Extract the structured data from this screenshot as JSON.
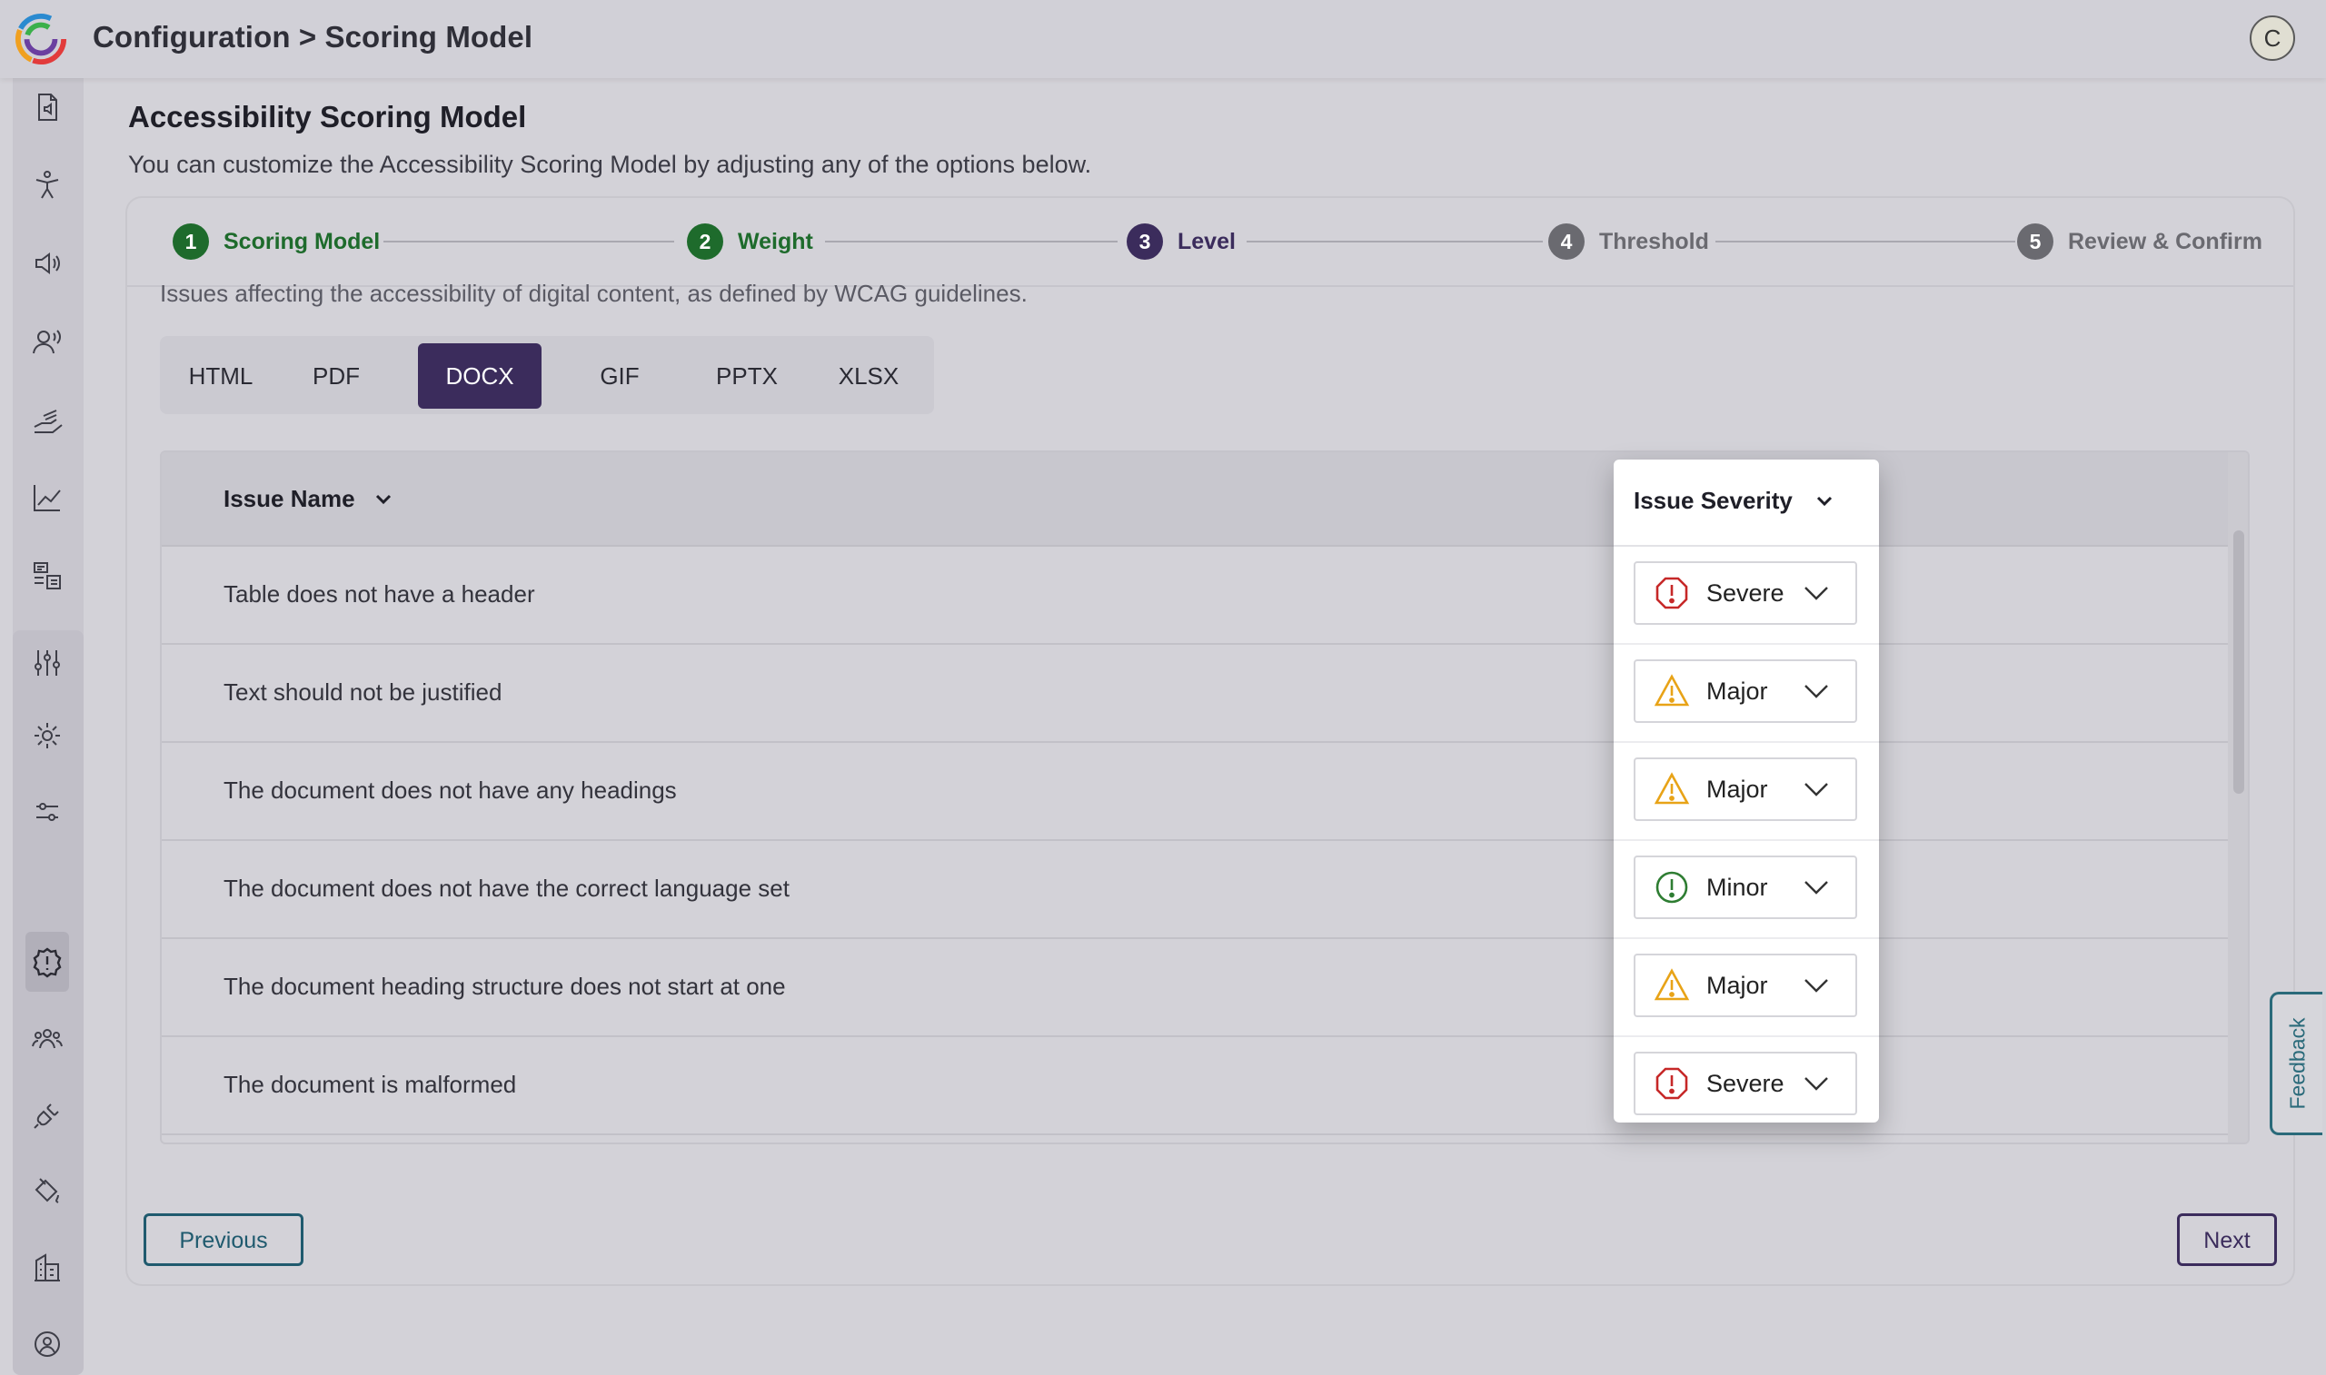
{
  "header": {
    "breadcrumb": "Configuration > Scoring Model",
    "avatar_initial": "C"
  },
  "sidebar": {
    "items": [
      {
        "icon": "document-audio-icon"
      },
      {
        "icon": "accessibility-person-icon"
      },
      {
        "icon": "speaker-icon"
      },
      {
        "icon": "voice-user-icon"
      },
      {
        "icon": "hand-tools-icon"
      },
      {
        "icon": "line-chart-icon"
      },
      {
        "icon": "list-form-icon"
      },
      {
        "icon": "sliders-icon"
      },
      {
        "icon": "gear-icon"
      },
      {
        "icon": "filter-adjust-icon"
      },
      {
        "icon": "scoring-model-icon",
        "active": true
      },
      {
        "icon": "team-icon"
      },
      {
        "icon": "plug-icon"
      },
      {
        "icon": "paint-bucket-icon"
      },
      {
        "icon": "building-icon"
      },
      {
        "icon": "user-settings-icon"
      }
    ]
  },
  "page": {
    "title": "Accessibility Scoring Model",
    "subtitle": "You can customize the Accessibility Scoring Model by adjusting any of the options below."
  },
  "steps": [
    {
      "num": "1",
      "label": "Scoring Model",
      "state": "done"
    },
    {
      "num": "2",
      "label": "Weight",
      "state": "done"
    },
    {
      "num": "3",
      "label": "Level",
      "state": "current"
    },
    {
      "num": "4",
      "label": "Threshold",
      "state": "todo"
    },
    {
      "num": "5",
      "label": "Review & Confirm",
      "state": "todo"
    }
  ],
  "section": {
    "description_partial": "Issues affecting the accessibility of digital content, as defined by WCAG guidelines."
  },
  "format_tabs": {
    "items": [
      "HTML",
      "PDF",
      "DOCX",
      "GIF",
      "PPTX",
      "XLSX"
    ],
    "selected": "DOCX"
  },
  "table": {
    "col_issue_name": "Issue Name",
    "col_severity": "Issue Severity",
    "rows": [
      {
        "name": "Table does not have a header",
        "severity": "Severe"
      },
      {
        "name": "Text should not be justified",
        "severity": "Major"
      },
      {
        "name": "The document does not have any headings",
        "severity": "Major"
      },
      {
        "name": "The document does not have the correct language set",
        "severity": "Minor"
      },
      {
        "name": "The document heading structure does not start at one",
        "severity": "Major"
      },
      {
        "name": "The document is malformed",
        "severity": "Severe"
      }
    ]
  },
  "severity_colors": {
    "Severe": "#c62828",
    "Major": "#e8a317",
    "Minor": "#2e7d32"
  },
  "buttons": {
    "previous": "Previous",
    "next": "Next",
    "feedback": "Feedback"
  }
}
